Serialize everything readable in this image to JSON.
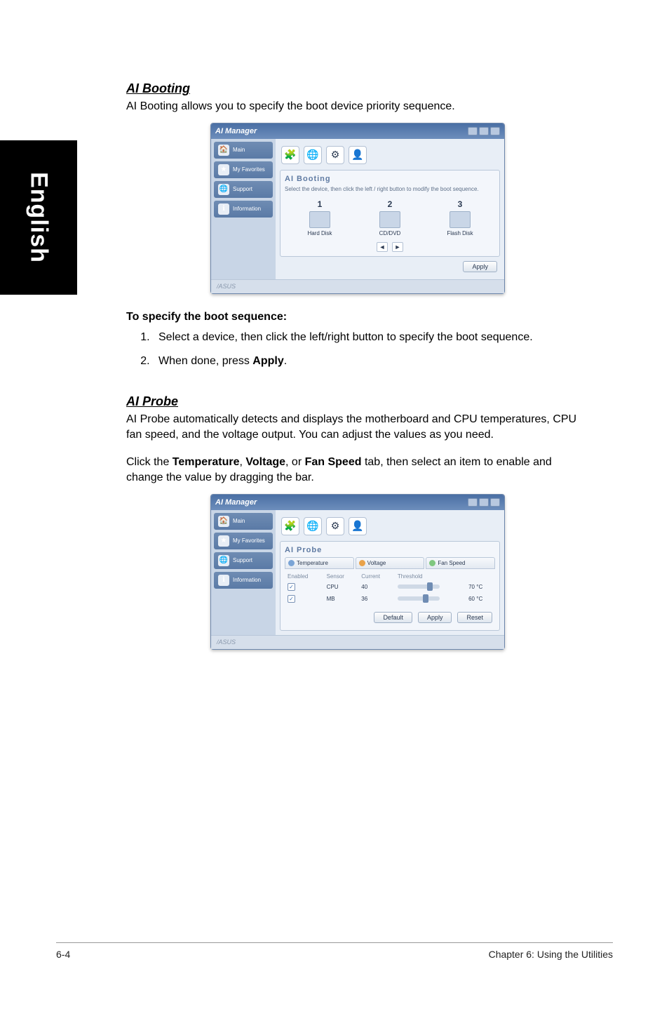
{
  "sidebar": {
    "language": "English"
  },
  "section1": {
    "heading": "AI Booting",
    "lead": "AI Booting allows you to specify the boot device priority sequence.",
    "sub_heading": "To specify the boot sequence:",
    "steps": {
      "s1": "Select a device, then click the left/right button to specify the boot sequence.",
      "s2_pre": "When done, press ",
      "s2_b": "Apply",
      "s2_post": "."
    }
  },
  "section2": {
    "heading": "AI Probe",
    "lead": "AI Probe automatically detects and displays the motherboard and CPU temperatures, CPU fan speed, and the voltage output. You can adjust the values as you need.",
    "para_pre": "Click the ",
    "b1": "Temperature",
    "c1": ", ",
    "b2": "Voltage",
    "c2": ", or ",
    "b3": "Fan Speed",
    "para_post": " tab, then select an item to enable and change the value by dragging the bar."
  },
  "app": {
    "title": "AI Manager",
    "nav": {
      "main": "Main",
      "fav": "My Favorites",
      "support": "Support",
      "info": "Information"
    },
    "tool_icons": {
      "a": "🧩",
      "b": "🌐",
      "c": "⚙",
      "d": "👤"
    },
    "booting": {
      "panel": "AI Booting",
      "hint": "Select the device, then click the left / right button to modify the boot sequence.",
      "devs": {
        "n1": "1",
        "n2": "2",
        "n3": "3",
        "l1": "Hard Disk",
        "l2": "CD/DVD",
        "l3": "Flash Disk"
      },
      "arrow_left": "◄",
      "arrow_right": "►",
      "apply": "Apply"
    },
    "probe": {
      "panel": "AI Probe",
      "tabs": {
        "t1": "Temperature",
        "t2": "Voltage",
        "t3": "Fan Speed"
      },
      "cols": {
        "c1": "Enabled",
        "c2": "Sensor",
        "c3": "Current",
        "c4": "Threshold"
      },
      "rows": {
        "r1_sensor": "CPU",
        "r1_cur": "40",
        "r1_unit": "°C",
        "r1_thr": "70",
        "r2_sensor": "MB",
        "r2_cur": "36",
        "r2_unit": "°C",
        "r2_thr": "60"
      },
      "btn_default": "Default",
      "btn_apply": "Apply",
      "btn_reset": "Reset"
    },
    "footer_brand": "/ASUS"
  },
  "page_footer": {
    "left": "6-4",
    "right": "Chapter 6: Using the Utilities"
  }
}
